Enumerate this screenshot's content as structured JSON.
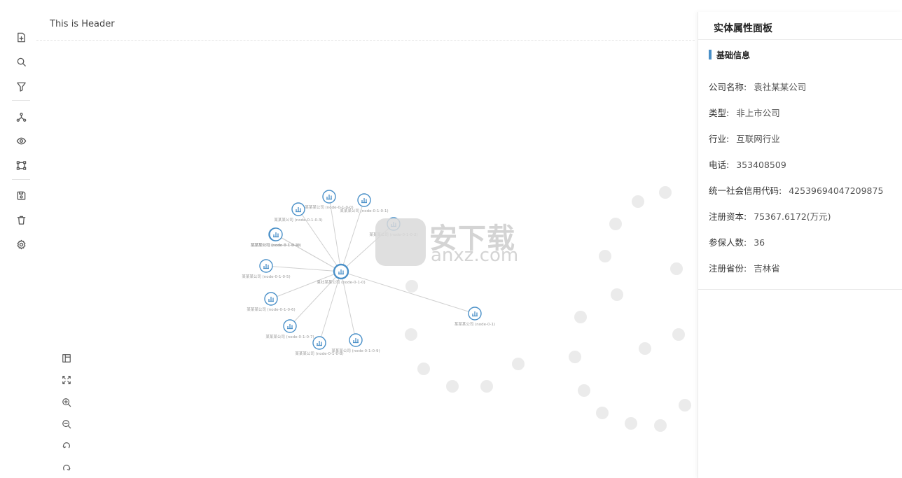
{
  "header": {
    "title": "This is Header"
  },
  "toolbar": {
    "items": [
      {
        "name": "new-file-icon"
      },
      {
        "name": "search-icon"
      },
      {
        "name": "filter-icon"
      },
      {
        "name": "network-icon"
      },
      {
        "name": "eye-icon"
      },
      {
        "name": "select-box-icon"
      },
      {
        "name": "save-icon"
      },
      {
        "name": "trash-icon"
      },
      {
        "name": "gear-icon"
      }
    ]
  },
  "bottom_tools": [
    {
      "name": "minimap-icon"
    },
    {
      "name": "fit-view-icon"
    },
    {
      "name": "zoom-in-icon"
    },
    {
      "name": "zoom-out-icon"
    },
    {
      "name": "undo-icon"
    },
    {
      "name": "redo-icon"
    }
  ],
  "graph": {
    "center": {
      "label": "袁社某某公司 (node-0-1-0)"
    },
    "nodes": [
      {
        "label": "某某某公司 (node-0-1-0-0)"
      },
      {
        "label": "某某某公司 (node-0-1-0-1)"
      },
      {
        "label": "某某某公司 (node-0-1-0-2)"
      },
      {
        "label": "某某某公司 (node-0-1-0-3)"
      },
      {
        "label": "某某某公司 (node-0-1-0-4)"
      },
      {
        "label": "某某某公司 (node-0-1-0-5)"
      },
      {
        "label": "某某某公司 (node-0-1-0-6)"
      },
      {
        "label": "某某某公司 (node-0-1-0-7)"
      },
      {
        "label": "某某某公司 (node-0-1-0-8)"
      },
      {
        "label": "某某某公司 (node-0-1-0-9)"
      },
      {
        "label": "某某某公司 (node-0-1-0-10)"
      },
      {
        "label": "某某某公司 (node-0-1)"
      }
    ]
  },
  "watermark": {
    "title": "安下载",
    "domain": "anxz.com"
  },
  "panel": {
    "title": "实体属性面板",
    "section": "基础信息",
    "attributes": [
      {
        "label": "公司名称:",
        "value": "袁社某某公司"
      },
      {
        "label": "类型:",
        "value": "非上市公司"
      },
      {
        "label": "行业:",
        "value": "互联网行业"
      },
      {
        "label": "电话:",
        "value": "353408509"
      },
      {
        "label": "统一社会信用代码:",
        "value": "42539694047209875"
      },
      {
        "label": "注册资本:",
        "value": "75367.6172(万元)"
      },
      {
        "label": "参保人数:",
        "value": "36"
      },
      {
        "label": "注册省份:",
        "value": "吉林省"
      }
    ]
  },
  "colors": {
    "accent": "#4a90c8",
    "node": "#4a90c8",
    "edge": "#d0d0d0",
    "ghost": "#ebebeb"
  }
}
